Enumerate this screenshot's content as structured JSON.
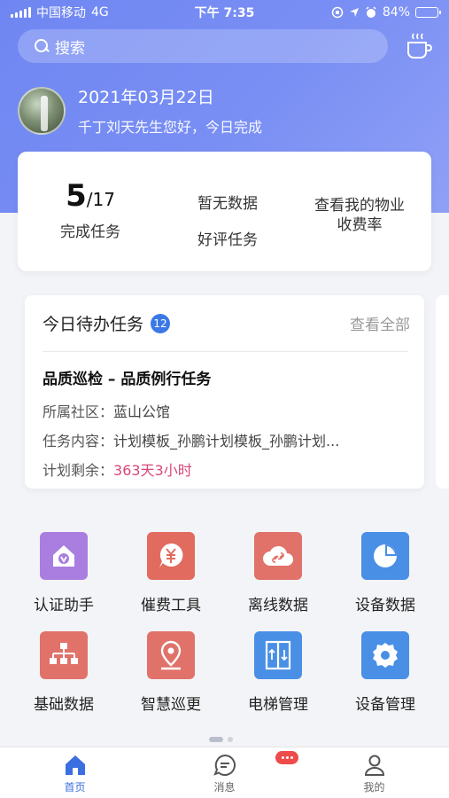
{
  "status_bar": {
    "carrier": "中国移动",
    "network": "4G",
    "time": "下午 7:35",
    "battery": "84%",
    "battery_level": 0.84
  },
  "search": {
    "placeholder": "搜索"
  },
  "greeting": {
    "date": "2021年03月22日",
    "message": "千丁刘天先生您好，今日完成"
  },
  "stats": {
    "done_count": "5",
    "total_count": "/17",
    "done_label": "完成任务",
    "no_data": "暂无数据",
    "good_review_label": "好评任务",
    "fee_rate_line1": "查看我的物业",
    "fee_rate_line2": "收费率"
  },
  "todo": {
    "title": "今日待办任务",
    "badge": "12",
    "view_all": "查看全部",
    "task_name": "品质巡检 – 品质例行任务",
    "community_label": "所属社区：",
    "community_value": "蓝山公馆",
    "content_label": "任务内容：",
    "content_value": "计划模板_孙鹏计划模板_孙鹏计划...",
    "remain_label": "计划剩余：",
    "remain_value": "363天3小时"
  },
  "grid": [
    {
      "label": "认证助手",
      "icon": "house-verify-icon",
      "color": "#a97ee0"
    },
    {
      "label": "催费工具",
      "icon": "yuan-bubble-icon",
      "color": "#e26b5f"
    },
    {
      "label": "离线数据",
      "icon": "cloud-link-icon",
      "color": "#e0726a"
    },
    {
      "label": "设备数据",
      "icon": "pie-chart-icon",
      "color": "#4a8fe6"
    },
    {
      "label": "基础数据",
      "icon": "org-tree-icon",
      "color": "#e0726a"
    },
    {
      "label": "智慧巡更",
      "icon": "map-pin-icon",
      "color": "#e0726a"
    },
    {
      "label": "电梯管理",
      "icon": "elevator-icon",
      "color": "#4a8fe6"
    },
    {
      "label": "设备管理",
      "icon": "gear-icon",
      "color": "#4a8fe6"
    }
  ],
  "tabs": [
    {
      "label": "首页",
      "icon": "home-icon"
    },
    {
      "label": "消息",
      "icon": "chat-icon"
    },
    {
      "label": "我的",
      "icon": "user-icon"
    }
  ],
  "colors": {
    "accent": "#3b6fe0",
    "hero": "#7a8ff4",
    "remain": "#d9467a"
  }
}
